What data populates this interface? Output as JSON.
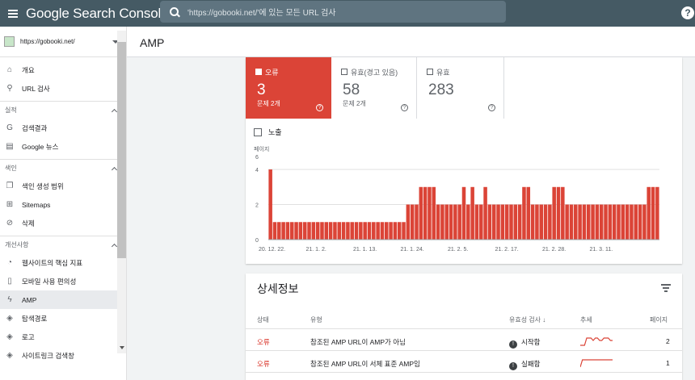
{
  "app": {
    "title": "Google Search Console"
  },
  "search": {
    "placeholder": "'https://gobooki.net/'에 있는 모든 URL 검사"
  },
  "property": {
    "url": "https://gobooki.net/"
  },
  "page": {
    "title": "AMP"
  },
  "sidebar": {
    "top_items": [
      {
        "icon": "home-icon",
        "label": "개요"
      },
      {
        "icon": "search-icon",
        "label": "URL 검사"
      }
    ],
    "sections": [
      {
        "label": "실적",
        "items": [
          {
            "icon": "google-icon",
            "label": "검색결과"
          },
          {
            "icon": "news-icon",
            "label": "Google 뉴스"
          }
        ]
      },
      {
        "label": "색인",
        "items": [
          {
            "icon": "file-copy-icon",
            "label": "색인 생성 범위"
          },
          {
            "icon": "sitemap-icon",
            "label": "Sitemaps"
          },
          {
            "icon": "visibility-off-icon",
            "label": "삭제"
          }
        ]
      },
      {
        "label": "개선사항",
        "items": [
          {
            "icon": "speed-icon",
            "label": "웹사이트의 핵심 지표"
          },
          {
            "icon": "phone-icon",
            "label": "모바일 사용 편의성"
          },
          {
            "icon": "bolt-icon",
            "label": "AMP",
            "active": true
          },
          {
            "icon": "layers-icon",
            "label": "탐색경로"
          },
          {
            "icon": "layers-icon",
            "label": "로고"
          },
          {
            "icon": "layers-icon",
            "label": "사이트링크 검색창"
          }
        ]
      }
    ]
  },
  "tabs": {
    "error": {
      "label": "오류",
      "value": "3",
      "sub": "문제 2개"
    },
    "warning": {
      "label": "유효(경고 있음)",
      "value": "58",
      "sub": "문제 2개"
    },
    "valid": {
      "label": "유효",
      "value": "283"
    }
  },
  "expose_label": "노출",
  "colors": {
    "error": "#db4437",
    "header": "#455a64"
  },
  "chart_data": {
    "type": "bar",
    "ylabel": "페이지",
    "ylabel_sub": "6",
    "y_ticks": [
      0,
      2,
      4
    ],
    "ylim": [
      0,
      4.6
    ],
    "x_tick_labels": [
      "20. 12. 22.",
      "21. 1. 2.",
      "21. 1. 13.",
      "21. 1. 24.",
      "21. 2. 5.",
      "21. 2. 17.",
      "21. 2. 28.",
      "21. 3. 11."
    ],
    "x_tick_indices": [
      0,
      11,
      22,
      33,
      44,
      55,
      66,
      77
    ],
    "values": [
      4,
      1,
      1,
      1,
      1,
      1,
      1,
      1,
      1,
      1,
      1,
      1,
      1,
      1,
      1,
      1,
      1,
      1,
      1,
      1,
      1,
      1,
      1,
      1,
      1,
      1,
      1,
      1,
      1,
      1,
      1,
      1,
      2,
      2,
      2,
      3,
      3,
      3,
      3,
      2,
      2,
      2,
      2,
      2,
      2,
      3,
      2,
      3,
      2,
      2,
      3,
      2,
      2,
      2,
      2,
      2,
      2,
      2,
      2,
      3,
      3,
      2,
      2,
      2,
      2,
      2,
      3,
      3,
      3,
      2,
      2,
      2,
      2,
      2,
      2,
      2,
      2,
      2,
      2,
      2,
      2,
      2,
      2,
      2,
      2,
      2,
      2,
      2,
      3,
      3,
      3
    ],
    "color": "#db4437"
  },
  "details": {
    "title": "상세정보",
    "columns": [
      "상태",
      "유형",
      "유효성 검사",
      "추세",
      "페이지"
    ],
    "sort_arrow": "↓",
    "rows": [
      {
        "status": "오류",
        "type": "참조된 AMP URL이 AMP가 아님",
        "validation": "시작함",
        "pages": "2",
        "trend": [
          0,
          0,
          0,
          3,
          3,
          3,
          2,
          3,
          3,
          2,
          2,
          3,
          3,
          3,
          2,
          2
        ]
      },
      {
        "status": "오류",
        "type": "참조된 AMP URL이 서체 표준 AMP임",
        "validation": "실패함",
        "pages": "1",
        "trend": [
          0,
          1,
          1,
          1,
          1,
          1,
          1,
          1,
          1,
          1,
          1,
          1,
          1,
          1,
          1,
          1
        ]
      }
    ]
  }
}
